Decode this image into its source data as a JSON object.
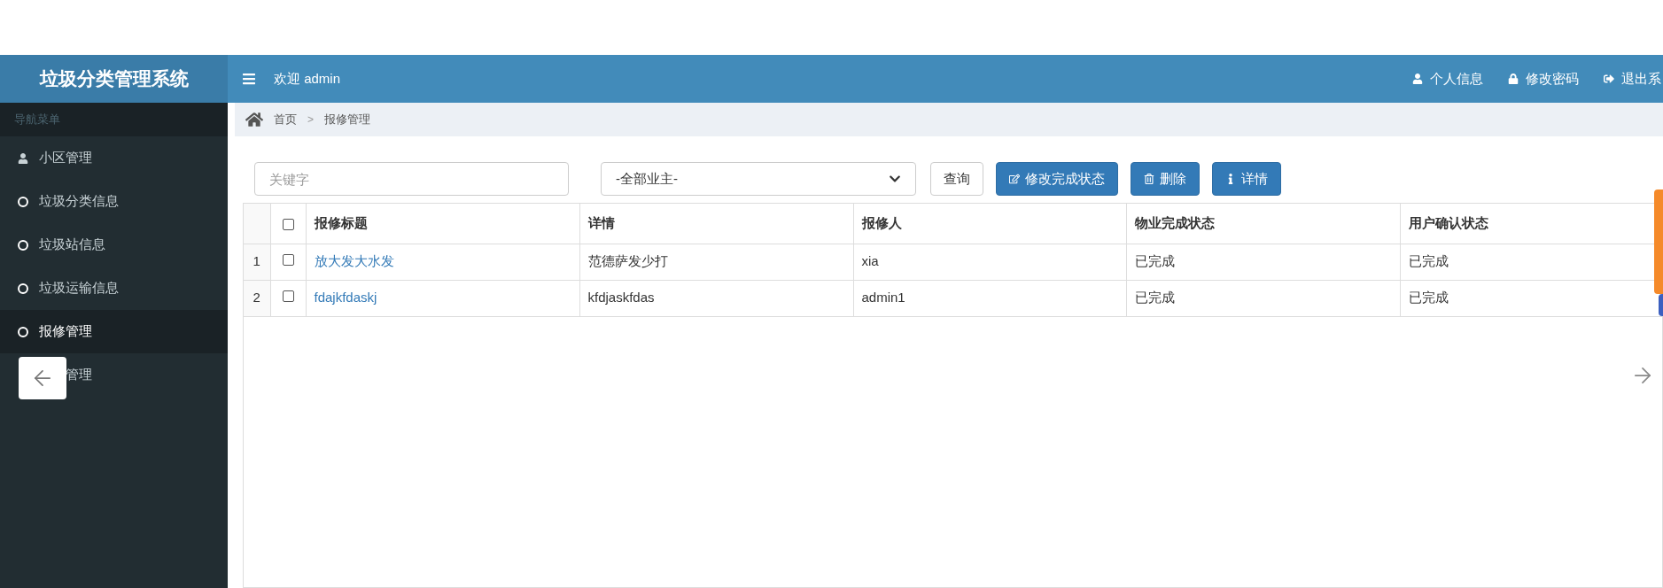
{
  "header": {
    "title": "垃圾分类管理系统",
    "welcome": "欢迎 admin",
    "links": [
      {
        "kind": "user",
        "label": "个人信息"
      },
      {
        "kind": "lock",
        "label": "修改密码"
      },
      {
        "kind": "logout",
        "label": "退出系"
      }
    ]
  },
  "sidebar": {
    "heading": "导航菜单",
    "items": [
      {
        "kind": "user",
        "label": "小区管理",
        "selected": false
      },
      {
        "kind": "circle",
        "label": "垃圾分类信息",
        "selected": false
      },
      {
        "kind": "circle",
        "label": "垃圾站信息",
        "selected": false
      },
      {
        "kind": "circle",
        "label": "垃圾运输信息",
        "selected": false
      },
      {
        "kind": "circle",
        "label": "报修管理",
        "selected": true
      },
      {
        "kind": "covered",
        "label": "管理",
        "selected": false
      }
    ]
  },
  "breadcrumb": [
    "首页",
    ">",
    "报修管理"
  ],
  "toolbar": {
    "search": {
      "placeholder": "关键字"
    },
    "owner_select": {
      "value": "-全部业主-"
    },
    "buttons": [
      {
        "kind": "plain",
        "label": "查询"
      },
      {
        "kind": "edit",
        "label": "修改完成状态"
      },
      {
        "kind": "delete",
        "label": "删除"
      },
      {
        "kind": "info",
        "label": "详情"
      }
    ]
  },
  "table": {
    "select_all": {
      "checked": false
    },
    "columns": [
      "报修标题",
      "详情",
      "报修人",
      "物业完成状态",
      "用户确认状态"
    ],
    "rows": [
      {
        "index": "1",
        "checked": false,
        "cells": [
          "放大发大水发",
          "范德萨发少打",
          "xia",
          "已完成",
          "已完成"
        ]
      },
      {
        "index": "2",
        "checked": false,
        "cells": [
          "fdajkfdaskj",
          "kfdjaskfdas",
          "admin1",
          "已完成",
          "已完成"
        ]
      }
    ]
  }
}
